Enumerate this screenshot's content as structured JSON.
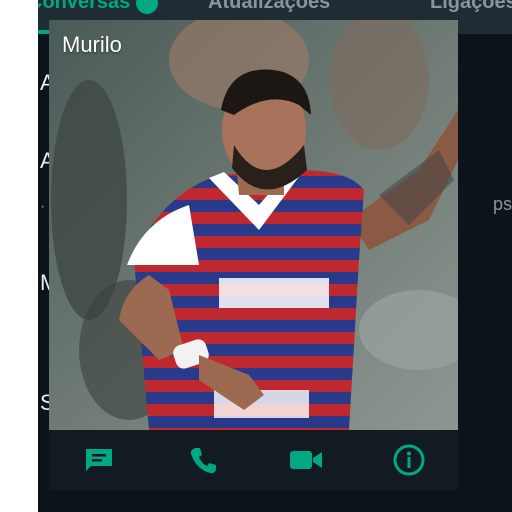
{
  "background": {
    "tabs": [
      "Conversas",
      "Atualizações",
      "Ligações"
    ],
    "list_fragments": [
      "A",
      "A",
      "M",
      "S",
      "ps"
    ]
  },
  "dialog": {
    "contact_name": "Murilo",
    "actions": [
      {
        "icon": "message-icon",
        "label": "Message"
      },
      {
        "icon": "phone-icon",
        "label": "Voice call"
      },
      {
        "icon": "video-icon",
        "label": "Video call"
      },
      {
        "icon": "info-icon",
        "label": "Info"
      }
    ]
  },
  "colors": {
    "accent": "#00a884",
    "panel": "#111b21",
    "app_background": "#0b141a"
  }
}
